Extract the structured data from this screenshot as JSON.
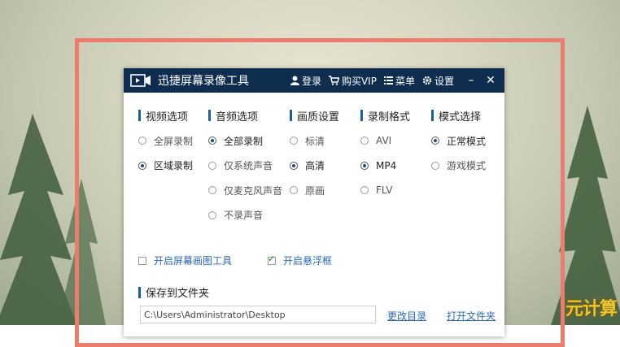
{
  "window": {
    "title": "迅捷屏幕录像工具",
    "toolbar": {
      "login": "登录",
      "vip": "购买VIP",
      "menu": "菜单",
      "settings": "设置"
    }
  },
  "sections": {
    "video": {
      "title": "视频选项",
      "options": [
        "全屏录制",
        "区域录制"
      ],
      "selected": 1
    },
    "audio": {
      "title": "音频选项",
      "options": [
        "全部录制",
        "仅系统声音",
        "仅麦克风声音",
        "不录声音"
      ],
      "selected": 0
    },
    "quality": {
      "title": "画质设置",
      "options": [
        "标清",
        "高清",
        "原画"
      ],
      "selected": 1
    },
    "format": {
      "title": "录制格式",
      "options": [
        "AVI",
        "MP4",
        "FLV"
      ],
      "selected": 1
    },
    "mode": {
      "title": "模式选择",
      "options": [
        "正常模式",
        "游戏模式"
      ],
      "selected": 0
    }
  },
  "checkboxes": {
    "screen_draw": {
      "label": "开启屏幕画图工具",
      "checked": false
    },
    "float_box": {
      "label": "开启悬浮框",
      "checked": true
    }
  },
  "save": {
    "title": "保存到文件夹",
    "path": "C:\\Users\\Administrator\\Desktop",
    "change_dir": "更改目录",
    "open_folder": "打开文件夹"
  },
  "watermark": "元计算",
  "colors": {
    "titlebar": "#0f2e4f",
    "accent": "#1f5d9b",
    "frame": "#ee7c6c",
    "link": "#2b6bb3"
  }
}
